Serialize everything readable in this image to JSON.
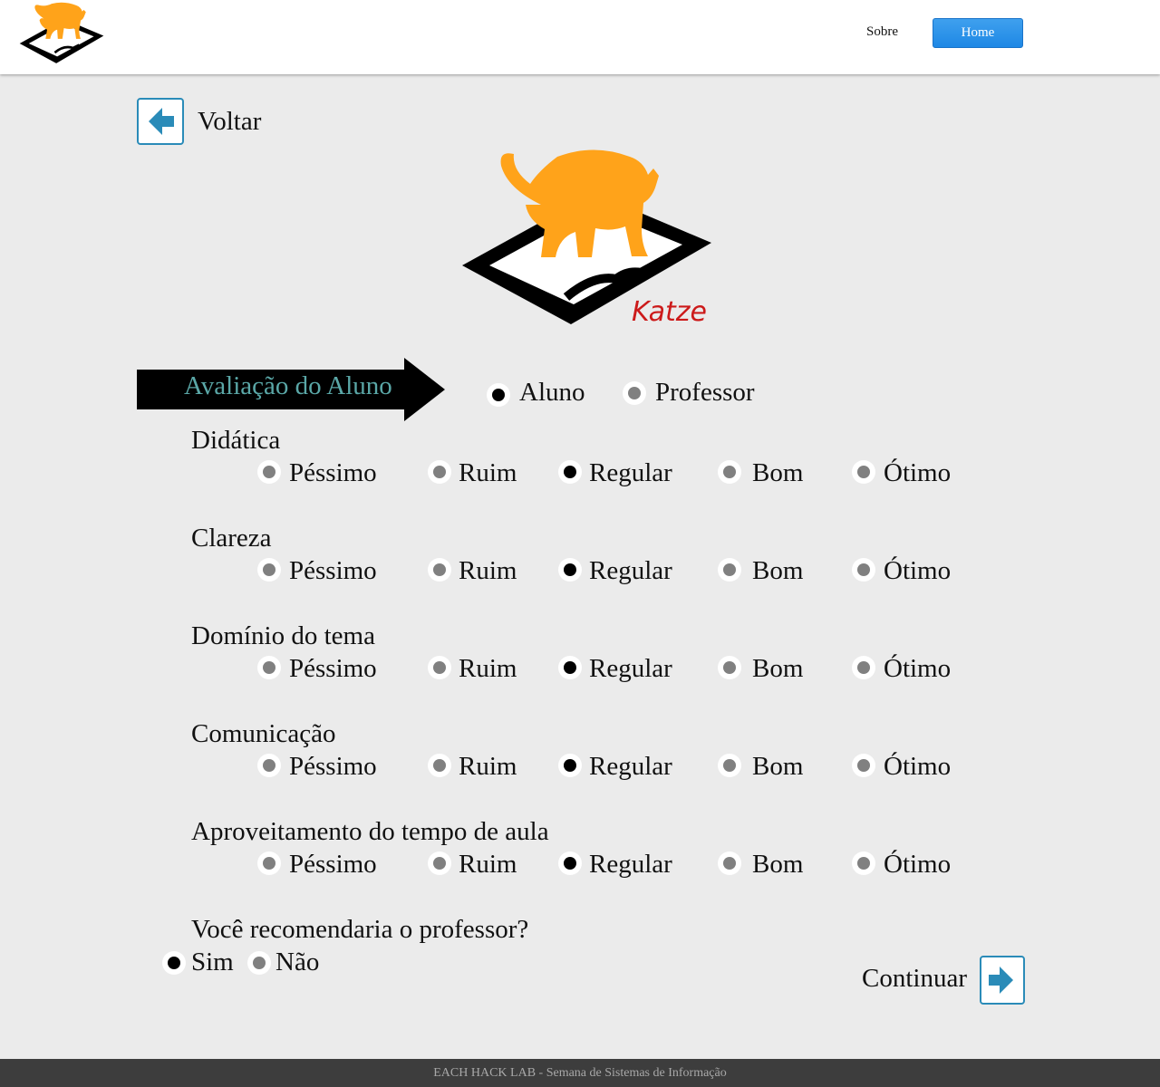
{
  "header": {
    "nav_sobre": "Sobre",
    "nav_home": "Home",
    "accent_color": "#1e88e5"
  },
  "back": {
    "label": "Voltar",
    "icon": "arrow-left-icon"
  },
  "logo": {
    "text": "Katze",
    "cat_color": "#ffa31a",
    "text_color": "#cc1a1a"
  },
  "banner": {
    "title": "Avaliação do Aluno",
    "text_color": "#5aa7a7"
  },
  "role": {
    "options": [
      "Aluno",
      "Professor"
    ],
    "selected": "Aluno"
  },
  "ratings": {
    "options": [
      "Péssimo",
      "Ruim",
      "Regular",
      "Bom",
      "Ótimo"
    ],
    "questions": [
      {
        "label": "Didática",
        "selected": "Regular"
      },
      {
        "label": "Clareza",
        "selected": "Regular"
      },
      {
        "label": "Domínio do tema",
        "selected": "Regular"
      },
      {
        "label": "Comunicação",
        "selected": "Regular"
      },
      {
        "label": "Aproveitamento do tempo de aula",
        "selected": "Regular"
      }
    ]
  },
  "recommend": {
    "question": "Você recomendaria o professor?",
    "options": [
      "Sim",
      "Não"
    ],
    "selected": "Sim"
  },
  "continue": {
    "label": "Continuar",
    "icon": "arrow-right-icon"
  },
  "footer": {
    "text": "EACH HACK LAB - Semana de Sistemas de Informação"
  }
}
